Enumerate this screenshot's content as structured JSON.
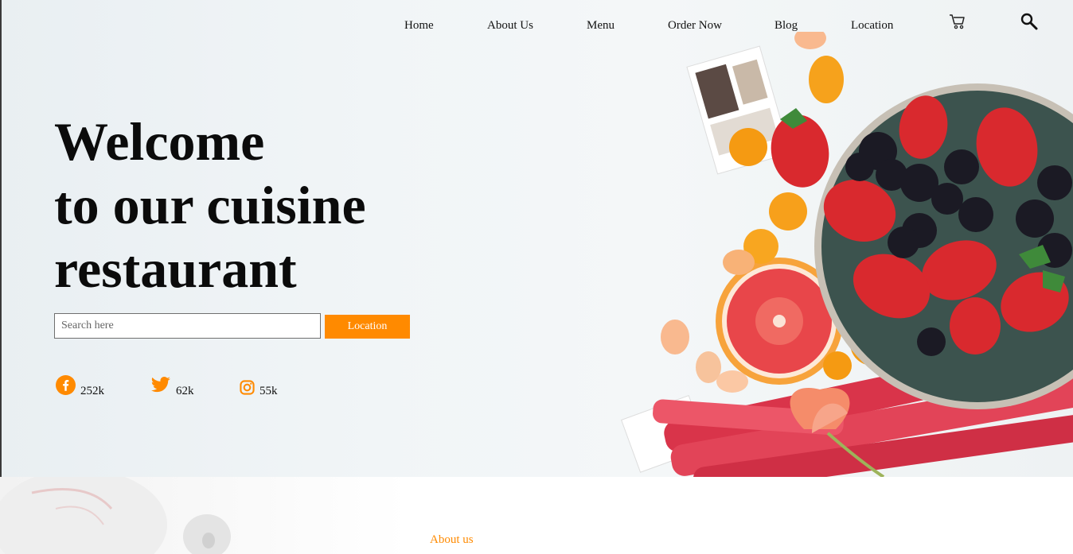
{
  "nav": {
    "items": [
      {
        "label": "Home"
      },
      {
        "label": "About Us"
      },
      {
        "label": "Menu"
      },
      {
        "label": "Order Now"
      },
      {
        "label": "Blog"
      },
      {
        "label": "Location"
      }
    ],
    "cart_icon": "cart-icon",
    "search_icon": "search-icon"
  },
  "hero": {
    "title_line1": "Welcome",
    "title_line2": "to our cuisine",
    "title_line3": "restaurant",
    "search_placeholder": "Search here",
    "location_button": "Location",
    "social": [
      {
        "icon": "facebook-icon",
        "count": "252k"
      },
      {
        "icon": "twitter-icon",
        "count": "62k"
      },
      {
        "icon": "instagram-icon",
        "count": "55k"
      }
    ]
  },
  "about": {
    "label": "About us"
  },
  "colors": {
    "accent": "#ff8a00",
    "text": "#0b0b0b"
  }
}
